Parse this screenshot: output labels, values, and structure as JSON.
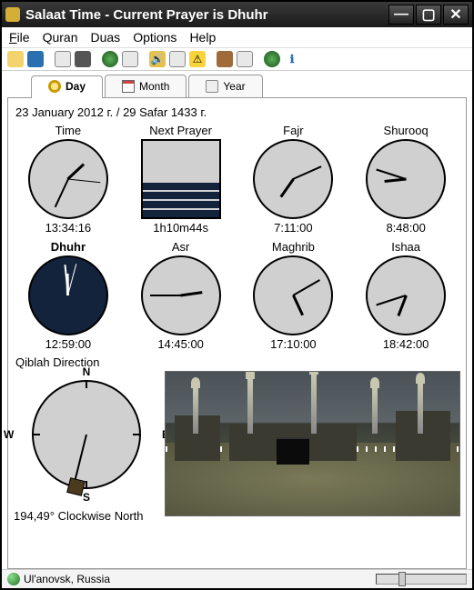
{
  "title": "Salaat Time - Current Prayer is Dhuhr",
  "menu": {
    "file": "File",
    "quran": "Quran",
    "duas": "Duas",
    "options": "Options",
    "help": "Help"
  },
  "tabs": {
    "day": "Day",
    "month": "Month",
    "year": "Year"
  },
  "date_line": "23 January 2012 г. / 29 Safar 1433 г.",
  "labels": {
    "time": "Time",
    "next": "Next Prayer",
    "fajr": "Fajr",
    "shurooq": "Shurooq",
    "dhuhr": "Dhuhr",
    "asr": "Asr",
    "maghrib": "Maghrib",
    "ishaa": "Ishaa",
    "qiblah": "Qiblah Direction"
  },
  "values": {
    "time": "13:34:16",
    "next": "1h10m44s",
    "fajr": "7:11:00",
    "shurooq": "8:48:00",
    "dhuhr": "12:59:00",
    "asr": "14:45:00",
    "maghrib": "17:10:00",
    "ishaa": "18:42:00",
    "qiblah": "194,49° Clockwise North"
  },
  "compass": {
    "n": "N",
    "s": "S",
    "e": "E",
    "w": "W"
  },
  "status": {
    "location": "Ul'anovsk, Russia"
  }
}
